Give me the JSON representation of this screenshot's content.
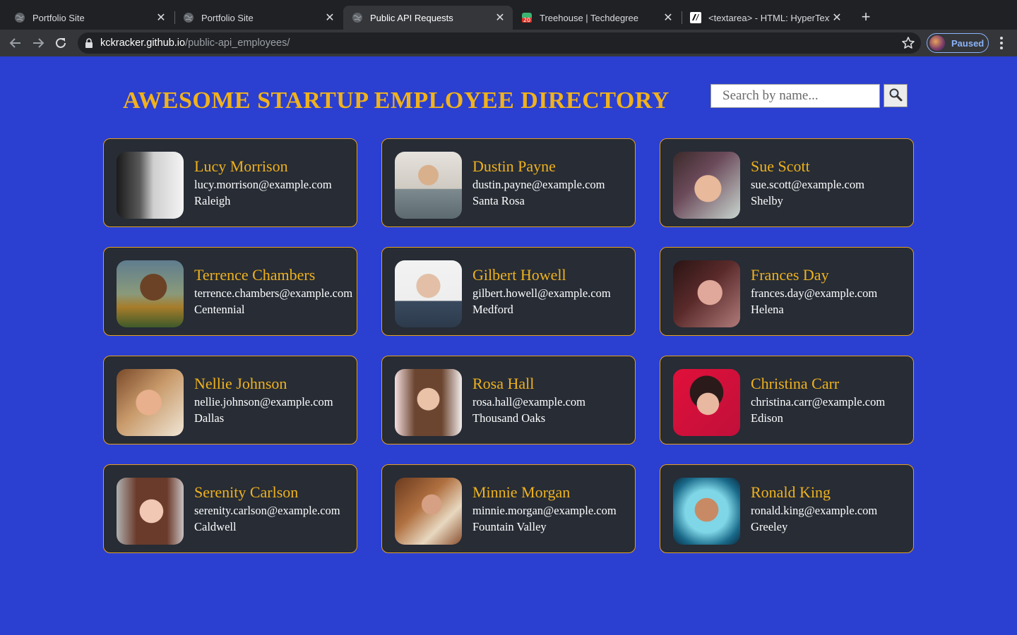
{
  "browser": {
    "tabs": [
      {
        "title": "Portfolio Site",
        "favicon": "globe-icon",
        "active": false
      },
      {
        "title": "Portfolio Site",
        "favicon": "globe-icon",
        "active": false
      },
      {
        "title": "Public API Requests",
        "favicon": "globe-icon",
        "active": true
      },
      {
        "title": "Treehouse | Techdegree",
        "favicon": "treehouse-icon",
        "active": false
      },
      {
        "title": "<textarea> - HTML: HyperText",
        "favicon": "mdn-icon",
        "active": false
      }
    ],
    "url_host": "kckracker.github.io",
    "url_path": "/public-api_employees/",
    "profile_label": "Paused"
  },
  "page": {
    "title": "AWESOME STARTUP EMPLOYEE DIRECTORY",
    "search_placeholder": "Search by name...",
    "search_icon": "magnifier-icon",
    "colors": {
      "background": "#2b3fd1",
      "card": "#272c35",
      "accent": "#f0b21c"
    }
  },
  "employees": [
    {
      "name": "Lucy Morrison",
      "email": "lucy.morrison@example.com",
      "city": "Raleigh"
    },
    {
      "name": "Dustin Payne",
      "email": "dustin.payne@example.com",
      "city": "Santa Rosa"
    },
    {
      "name": "Sue Scott",
      "email": "sue.scott@example.com",
      "city": "Shelby"
    },
    {
      "name": "Terrence Chambers",
      "email": "terrence.chambers@example.com",
      "city": "Centennial"
    },
    {
      "name": "Gilbert Howell",
      "email": "gilbert.howell@example.com",
      "city": "Medford"
    },
    {
      "name": "Frances Day",
      "email": "frances.day@example.com",
      "city": "Helena"
    },
    {
      "name": "Nellie Johnson",
      "email": "nellie.johnson@example.com",
      "city": "Dallas"
    },
    {
      "name": "Rosa Hall",
      "email": "rosa.hall@example.com",
      "city": "Thousand Oaks"
    },
    {
      "name": "Christina Carr",
      "email": "christina.carr@example.com",
      "city": "Edison"
    },
    {
      "name": "Serenity Carlson",
      "email": "serenity.carlson@example.com",
      "city": "Caldwell"
    },
    {
      "name": "Minnie Morgan",
      "email": "minnie.morgan@example.com",
      "city": "Fountain Valley"
    },
    {
      "name": "Ronald King",
      "email": "ronald.king@example.com",
      "city": "Greeley"
    }
  ]
}
